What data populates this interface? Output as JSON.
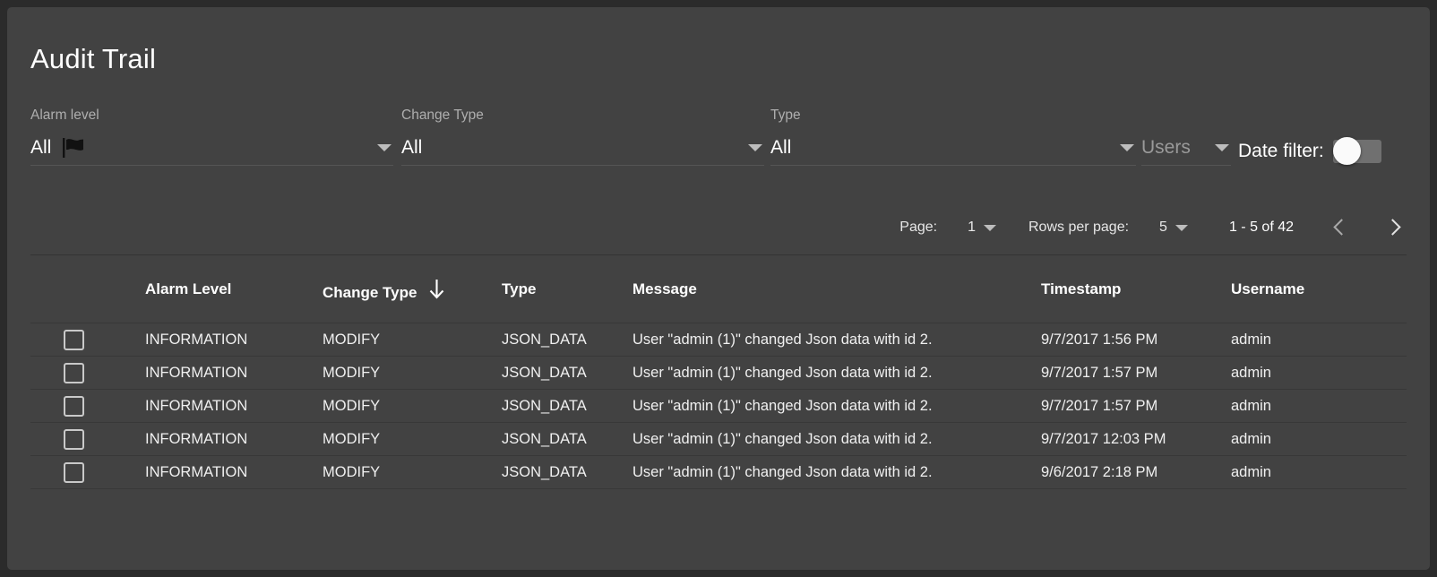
{
  "page": {
    "title": "Audit Trail"
  },
  "filters": {
    "alarm_level": {
      "label": "Alarm level",
      "value": "All",
      "icon": "flag-icon",
      "caret": "chevron-down-icon"
    },
    "change_type": {
      "label": "Change Type",
      "value": "All",
      "caret": "chevron-down-icon"
    },
    "type": {
      "label": "Type",
      "value": "All",
      "caret": "chevron-down-icon"
    },
    "users": {
      "placeholder": "Users",
      "value": "Users",
      "caret": "chevron-down-icon"
    },
    "date_filter": {
      "label": "Date filter:",
      "state": "off"
    }
  },
  "paginator": {
    "page_label": "Page:",
    "page_value": "1",
    "rows_label": "Rows per page:",
    "rows_value": "5",
    "range": "1 - 5 of 42",
    "prev_icon": "chevron-left-icon",
    "next_icon": "chevron-right-icon"
  },
  "table": {
    "columns": [
      "Alarm Level",
      "Change Type",
      "Type",
      "Message",
      "Timestamp",
      "Username"
    ],
    "sort": {
      "column": "Change Type",
      "direction": "descending",
      "icon": "arrow-down-icon"
    },
    "rows": [
      {
        "alarm_level": "INFORMATION",
        "change_type": "MODIFY",
        "type": "JSON_DATA",
        "message": "User \"admin (1)\" changed Json data with id 2.",
        "timestamp": "9/7/2017 1:56 PM",
        "username": "admin",
        "selected": false
      },
      {
        "alarm_level": "INFORMATION",
        "change_type": "MODIFY",
        "type": "JSON_DATA",
        "message": "User \"admin (1)\" changed Json data with id 2.",
        "timestamp": "9/7/2017 1:57 PM",
        "username": "admin",
        "selected": false
      },
      {
        "alarm_level": "INFORMATION",
        "change_type": "MODIFY",
        "type": "JSON_DATA",
        "message": "User \"admin (1)\" changed Json data with id 2.",
        "timestamp": "9/7/2017 1:57 PM",
        "username": "admin",
        "selected": false
      },
      {
        "alarm_level": "INFORMATION",
        "change_type": "MODIFY",
        "type": "JSON_DATA",
        "message": "User \"admin (1)\" changed Json data with id 2.",
        "timestamp": "9/7/2017 12:03 PM",
        "username": "admin",
        "selected": false
      },
      {
        "alarm_level": "INFORMATION",
        "change_type": "MODIFY",
        "type": "JSON_DATA",
        "message": "User \"admin (1)\" changed Json data with id 2.",
        "timestamp": "9/6/2017 2:18 PM",
        "username": "admin",
        "selected": false
      }
    ]
  },
  "colors": {
    "page_background": "#2b2b2b",
    "panel_background": "#424242",
    "text_primary": "#ffffff",
    "text_muted": "#aeaeae",
    "divider": "#383838"
  }
}
